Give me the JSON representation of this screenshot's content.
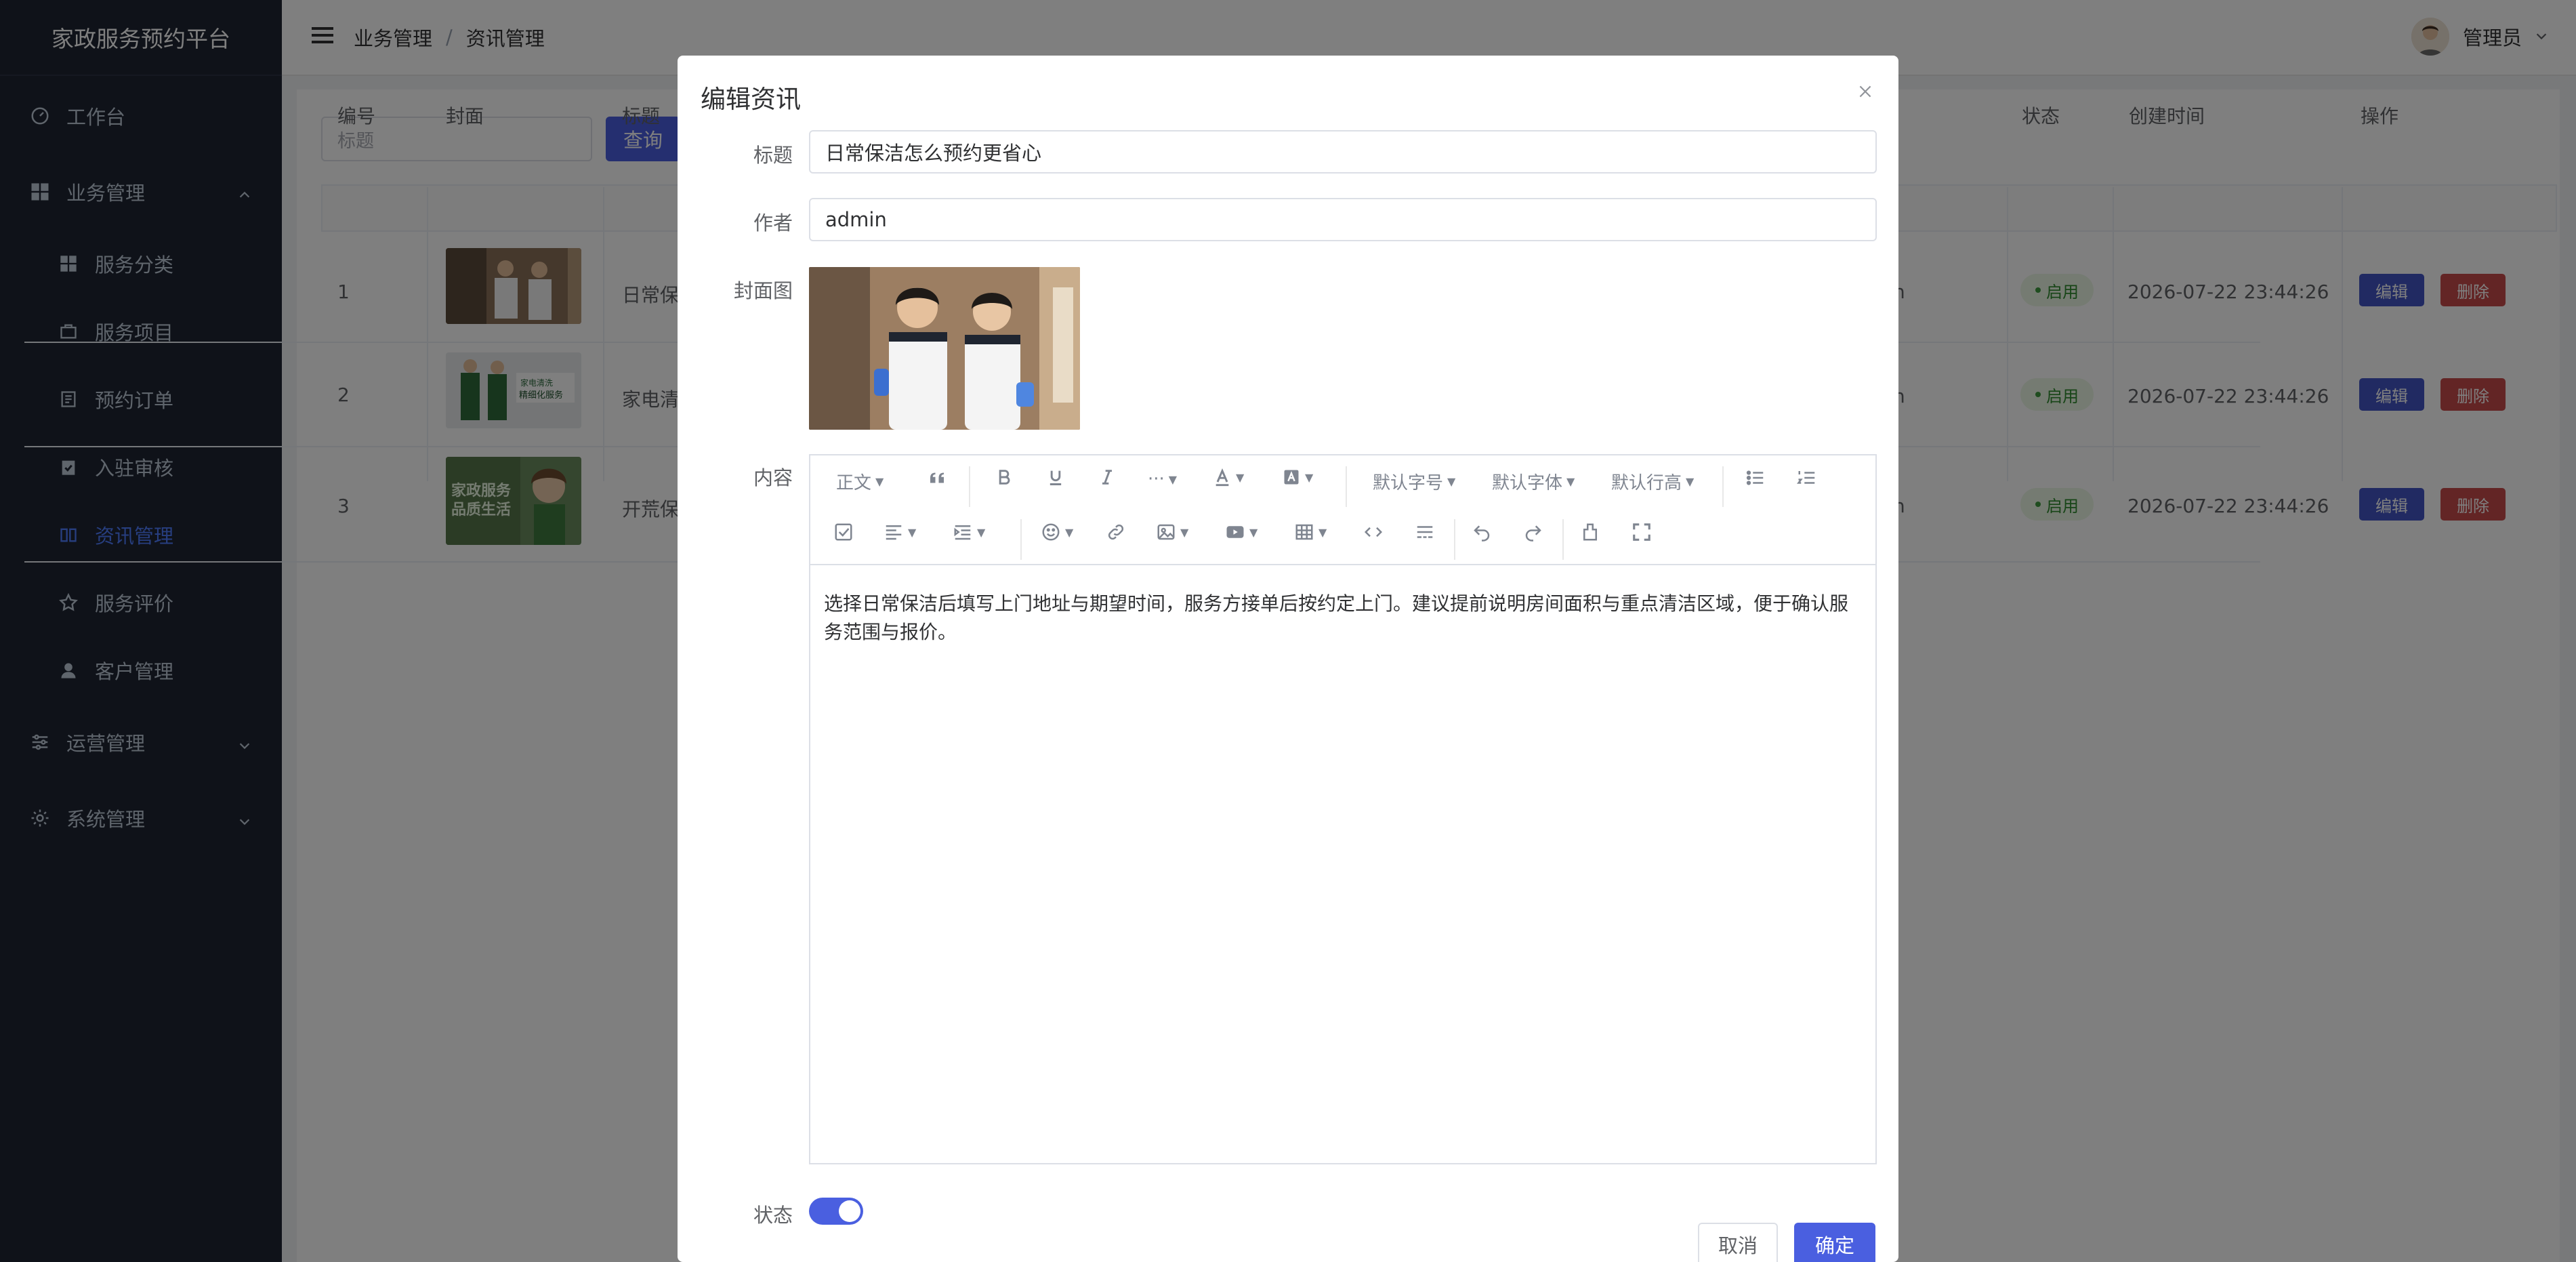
{
  "app": {
    "title": "家政服务预约平台"
  },
  "sidebar": {
    "items": [
      {
        "label": "工作台",
        "icon": "gauge-icon"
      },
      {
        "label": "业务管理",
        "icon": "grid-icon",
        "expanded": true
      },
      {
        "label": "服务分类",
        "icon": "category-icon"
      },
      {
        "label": "服务项目",
        "icon": "briefcase-icon"
      },
      {
        "label": "预约订单",
        "icon": "order-icon"
      },
      {
        "label": "入驻审核",
        "icon": "clipboard-check-icon"
      },
      {
        "label": "资讯管理",
        "icon": "book-icon",
        "active": true
      },
      {
        "label": "服务评价",
        "icon": "star-icon"
      },
      {
        "label": "客户管理",
        "icon": "user-icon"
      },
      {
        "label": "运营管理",
        "icon": "sliders-icon"
      },
      {
        "label": "系统管理",
        "icon": "gear-icon"
      }
    ],
    "active_color": "#4e7cff"
  },
  "header": {
    "breadcrumb": [
      "业务管理",
      "资讯管理"
    ],
    "breadcrumb_sep": "/",
    "user_name": "管理员"
  },
  "search": {
    "placeholder": "标题",
    "button_label": "查询"
  },
  "table": {
    "columns": [
      "编号",
      "封面",
      "标题",
      "状态",
      "创建时间",
      "操作"
    ],
    "rows": [
      {
        "id": "1",
        "title": "日常保",
        "author_tail": "n",
        "status": "启用",
        "created": "2026-07-22 23:44:26"
      },
      {
        "id": "2",
        "title": "家电清",
        "author_tail": "n",
        "status": "启用",
        "created": "2026-07-22 23:44:26"
      },
      {
        "id": "3",
        "title": "开荒保",
        "author_tail": "n",
        "status": "启用",
        "created": "2026-07-22 23:44:26"
      }
    ],
    "edit_label": "编辑",
    "delete_label": "删除",
    "thumb_text_2a": "家电清洗",
    "thumb_text_2b": "精细化服务",
    "thumb_text_3a": "家政服务",
    "thumb_text_3b": "品质生活"
  },
  "modal": {
    "title": "编辑资讯",
    "fields": {
      "title_label": "标题",
      "title_value": "日常保洁怎么预约更省心",
      "author_label": "作者",
      "author_value": "admin",
      "cover_label": "封面图",
      "content_label": "内容",
      "status_label": "状态",
      "status_on": true
    },
    "toolbar": {
      "paragraph": "正文",
      "font_size": "默认字号",
      "font_family": "默认字体",
      "line_height": "默认行高",
      "more": "···"
    },
    "content": "选择日常保洁后填写上门地址与期望时间，服务方接单后按约定上门。建议提前说明房间面积与重点清洁区域，便于确认服务范围与报价。",
    "cancel_label": "取消",
    "confirm_label": "确定"
  },
  "colors": {
    "primary": "#4a5fe0",
    "danger": "#c74a4a",
    "success_bg": "#eaf6e5",
    "sidebar_bg": "#1f2432"
  }
}
